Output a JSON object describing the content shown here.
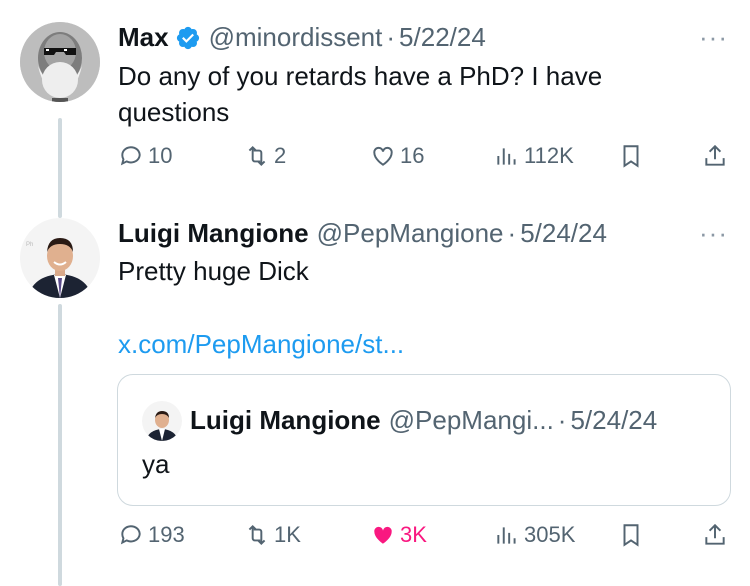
{
  "tweet1": {
    "name": "Max",
    "handle": "@minordissent",
    "separator": "·",
    "date": "5/22/24",
    "text_line1": "Do any of you retards have a PhD? I have",
    "text_line2": "questions",
    "more": "···",
    "replies": "10",
    "reposts": "2",
    "likes": "16",
    "views": "112K"
  },
  "tweet2": {
    "name": "Luigi Mangione",
    "handle": "@PepMangione",
    "separator": "·",
    "date": "5/24/24",
    "text": "Pretty huge Dick",
    "link": "x.com/PepMangione/st...",
    "more": "···",
    "replies": "193",
    "reposts": "1K",
    "likes": "3K",
    "views": "305K",
    "liked": true
  },
  "quote": {
    "name": "Luigi Mangione",
    "handle": "@PepMangi...",
    "separator": "·",
    "date": "5/24/24",
    "text": "ya"
  },
  "colors": {
    "accent": "#1d9bf0",
    "muted": "#536471",
    "like": "#f91880",
    "verified": "#1d9bf0"
  },
  "icons": [
    "reply-icon",
    "repost-icon",
    "like-icon",
    "views-icon",
    "bookmark-icon",
    "share-icon",
    "verified-icon",
    "more-icon"
  ]
}
